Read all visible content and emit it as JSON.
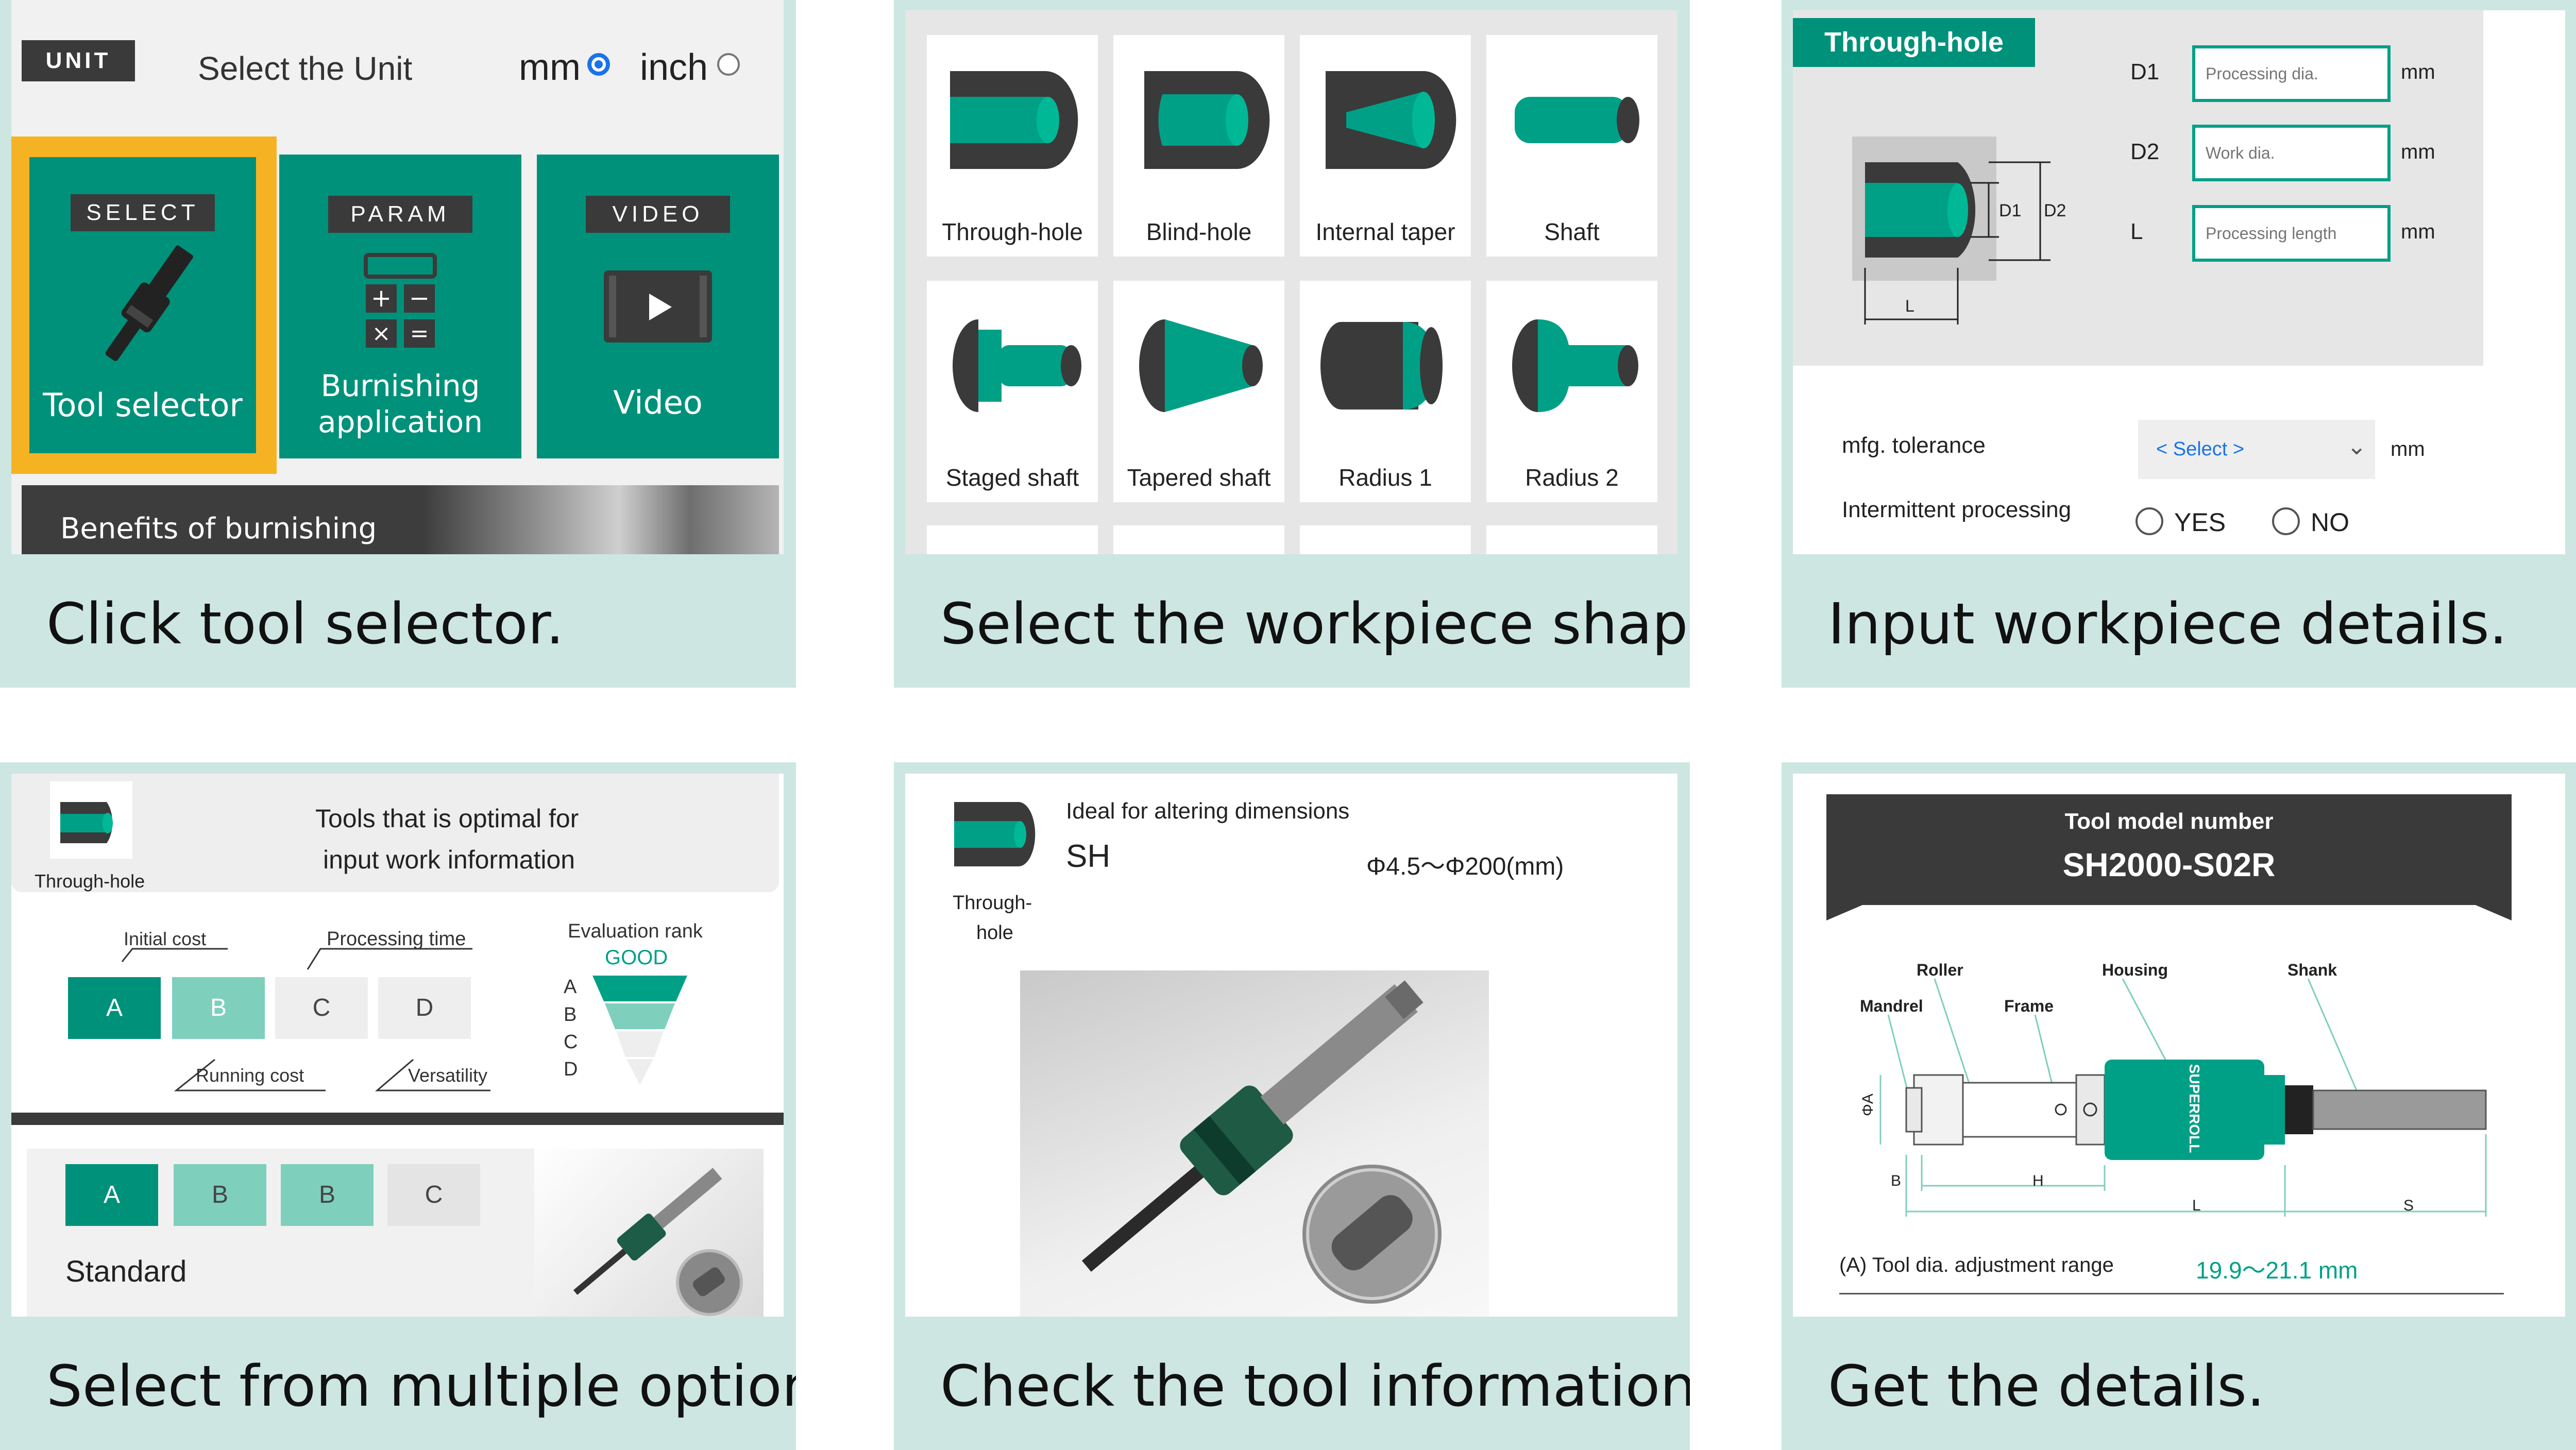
{
  "panel1": {
    "unit_tag": "UNIT",
    "select_unit_label": "Select the Unit",
    "unit_options": [
      {
        "label": "mm",
        "selected": true
      },
      {
        "label": "inch",
        "selected": false
      }
    ],
    "tiles": [
      {
        "tag": "SELECT",
        "label": "Tool selector",
        "icon": "burnishing-tool-icon"
      },
      {
        "tag": "PARAM",
        "label_line1": "Burnishing",
        "label_line2": "application",
        "icon": "calculator-icon"
      },
      {
        "tag": "VIDEO",
        "label": "Video",
        "icon": "play-icon"
      }
    ],
    "banner_text": "Benefits of burnishing",
    "caption": "Click tool selector."
  },
  "panel2": {
    "shapes": [
      "Through-hole",
      "Blind-hole",
      "Internal taper",
      "Shaft",
      "Staged shaft",
      "Tapered shaft",
      "Radius 1",
      "Radius 2"
    ],
    "caption": "Select the workpiece shape."
  },
  "panel3": {
    "header": "Through-hole",
    "diagram_labels": {
      "d1": "D1",
      "d2": "D2",
      "l": "L"
    },
    "fields": [
      {
        "label": "D1",
        "placeholder": "Processing dia.",
        "unit": "mm"
      },
      {
        "label": "D2",
        "placeholder": "Work dia.",
        "unit": "mm"
      },
      {
        "label": "L",
        "placeholder": "Processing length",
        "unit": "mm"
      }
    ],
    "tolerance_label": "mfg. tolerance",
    "tolerance_select": "< Select >",
    "tolerance_unit": "mm",
    "intermittent_label": "Intermittent processing",
    "yes_label": "YES",
    "no_label": "NO",
    "caption": "Input workpiece details."
  },
  "panel4": {
    "shape_label": "Through-hole",
    "title_line1": "Tools that is optimal for",
    "title_line2": "input work information",
    "initial_cost": "Initial cost",
    "processing_time": "Processing time",
    "running_cost": "Running cost",
    "versatility": "Versatility",
    "grades": [
      "A",
      "B",
      "C",
      "D"
    ],
    "evaluation_label": "Evaluation rank",
    "evaluation_value": "GOOD",
    "rank_letters": [
      "A",
      "B",
      "C",
      "D"
    ],
    "option_grades": [
      "A",
      "B",
      "B",
      "C"
    ],
    "option_name": "Standard",
    "caption": "Select from multiple options."
  },
  "panel5": {
    "shape_label_line1": "Through-",
    "shape_label_line2": "hole",
    "subtitle": "Ideal for altering dimensions",
    "model": "SH",
    "range": "Φ4.5〜Φ200(mm)",
    "caption": "Check the tool information."
  },
  "panel6": {
    "header_label": "Tool model number",
    "model_number": "SH2000-S02R",
    "parts": {
      "roller": "Roller",
      "housing": "Housing",
      "shank": "Shank",
      "mandrel": "Mandrel",
      "frame": "Frame"
    },
    "brand_text": "SUPERROLL",
    "dims": {
      "a": "ΦA",
      "b": "B",
      "h": "H",
      "l": "L",
      "s": "S"
    },
    "spec_label": "(A) Tool dia. adjustment range",
    "spec_value": "19.9〜21.1 mm",
    "caption": "Get the details."
  },
  "colors": {
    "teal": "#00917a",
    "teal_light": "#7fcfbd",
    "panel_bg": "#cde6e1",
    "dark": "#3a3a3a",
    "orange": "#f5b324"
  }
}
